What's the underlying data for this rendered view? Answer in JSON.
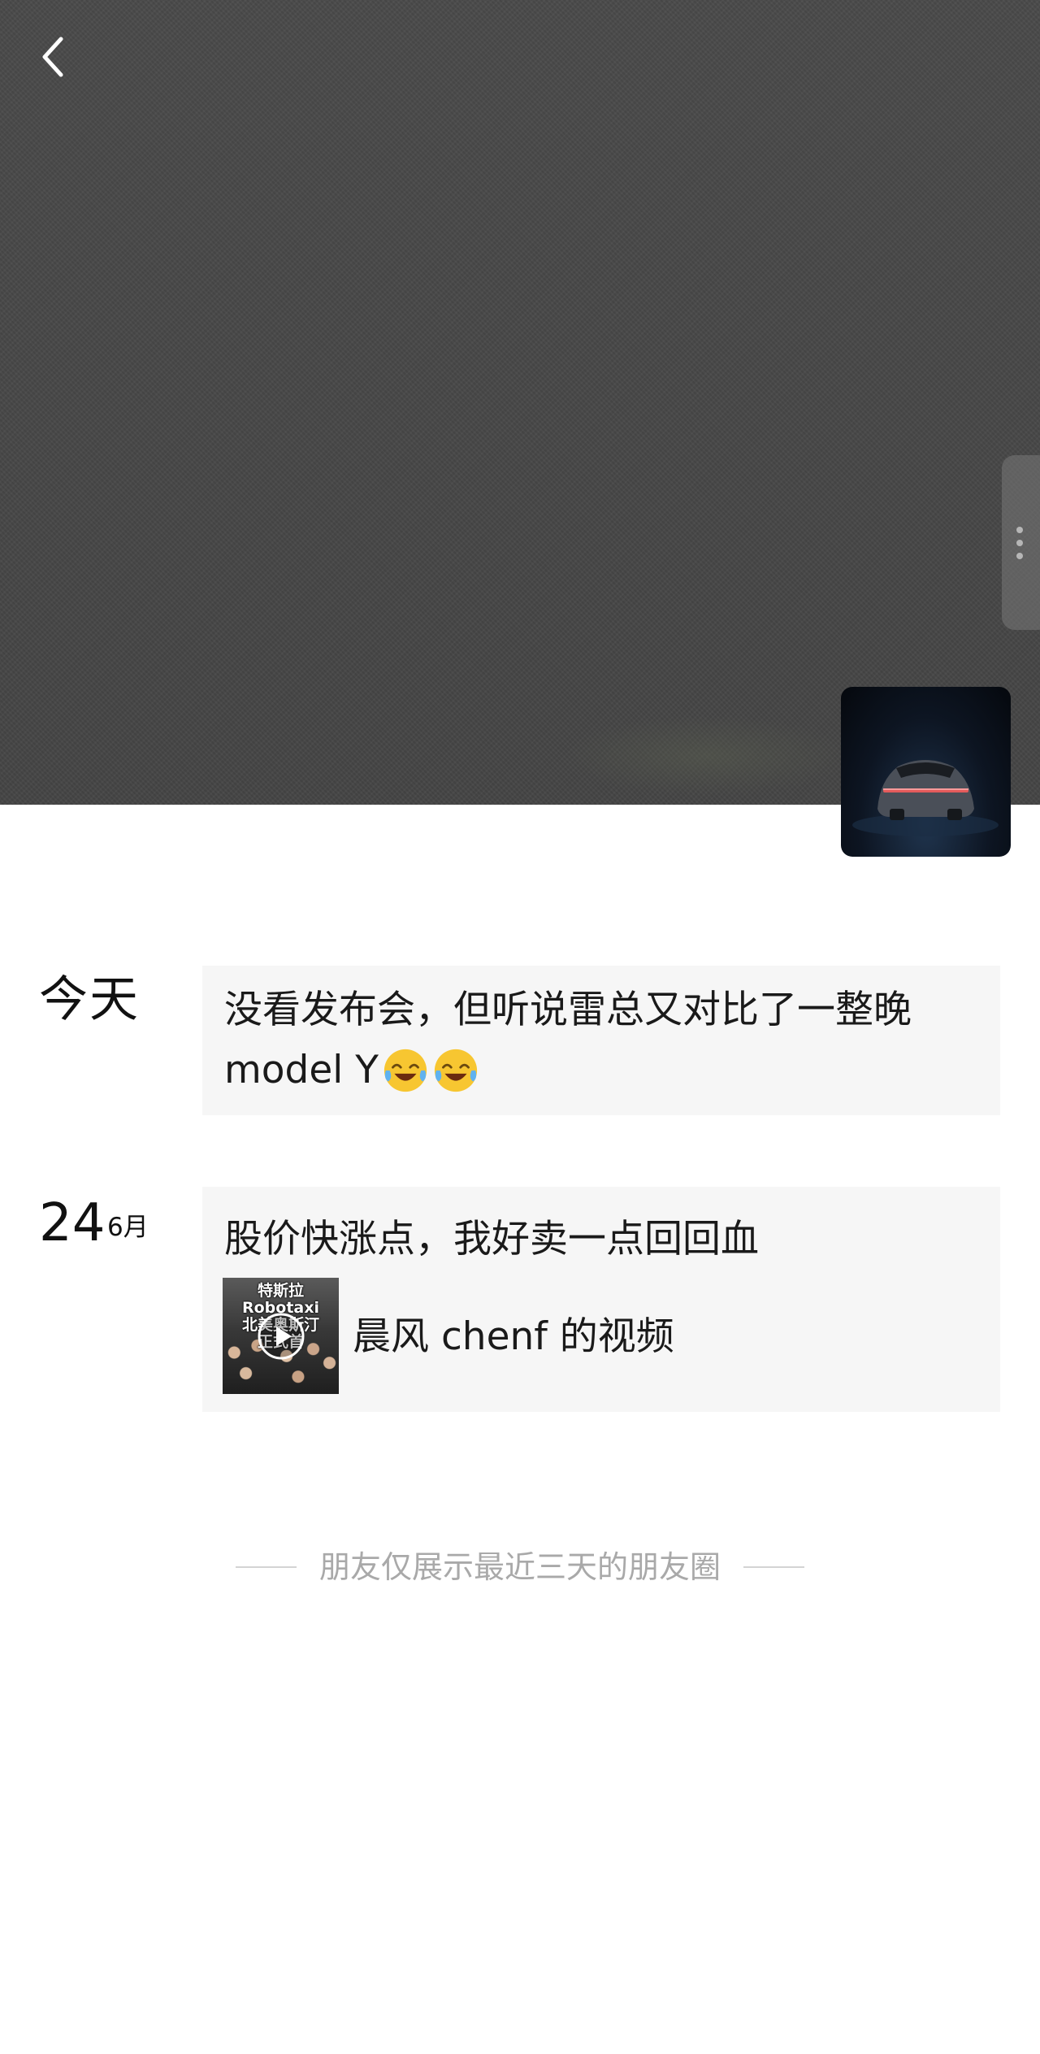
{
  "header": {
    "back_icon": "chevron-left-icon",
    "more_icon": "vertical-dots-icon"
  },
  "profile": {
    "avatar": "car-rear-lights-avatar"
  },
  "posts": [
    {
      "date_label": "今天",
      "text_line1": "没看发布会，但听说雷总又对比了一整晚",
      "text_line2": "model Y",
      "emojis": [
        "laugh-cry-emoji",
        "laugh-cry-emoji"
      ]
    },
    {
      "date_day": "24",
      "date_month": "6月",
      "text_line1": "股价快涨点，我好卖一点回回血",
      "video": {
        "thumbnail_caption_line1": "特斯拉Robotaxi",
        "thumbnail_caption_line2": "北美奥斯汀",
        "thumbnail_caption_line3": "正式首",
        "title": "晨风 chenf 的视频"
      }
    }
  ],
  "footer": {
    "note": "朋友仅展示最近三天的朋友圈"
  },
  "colors": {
    "cover": "#4a4a4a",
    "post_bg": "#f6f6f6",
    "footer_text": "#a9a9a9"
  }
}
